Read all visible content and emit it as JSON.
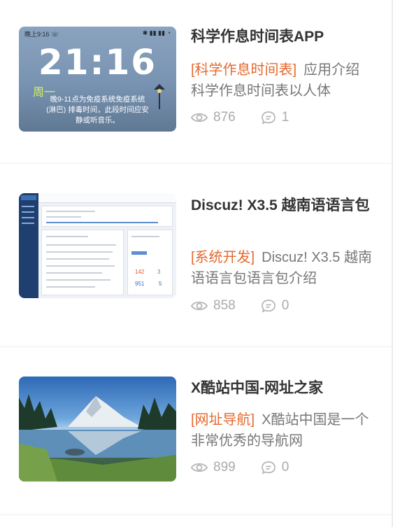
{
  "articles": [
    {
      "thumb_icon": "lockscreen-thumbnail",
      "thumb": {
        "status_left": "晚上9:16 ☏",
        "status_right": "✱ ▮▮ ▮▮ ◔",
        "clock": "21:16",
        "weekday": "周一",
        "line1": "晚9-11点为免疫系统免疫系统",
        "line2": "(淋巴) 排毒时间，此段时间应安",
        "line3": "静或听音乐。"
      },
      "title": "科学作息时间表APP",
      "category": "[科学作息时间表]",
      "excerpt": "应用介绍 科学作息时间表以人体",
      "views": "876",
      "comments": "1"
    },
    {
      "thumb_icon": "admin-screenshot-thumbnail",
      "thumb": {
        "num1": "142",
        "num2": "3",
        "num3": "951",
        "num4": "5"
      },
      "title": "Discuz! X3.5 越南语语言包",
      "category": "[系统开发]",
      "excerpt": "Discuz! X3.5 越南语语言包语言包介绍",
      "views": "858",
      "comments": "0"
    },
    {
      "thumb_icon": "mountain-lake-thumbnail",
      "title": "X酷站中国-网址之家",
      "category": "[网址导航]",
      "excerpt": "X酷站中国是一个非常优秀的导航网",
      "views": "899",
      "comments": "0"
    }
  ],
  "colors": {
    "category": "#e4692f",
    "meta": "#aaaaaa",
    "title": "#333333"
  }
}
